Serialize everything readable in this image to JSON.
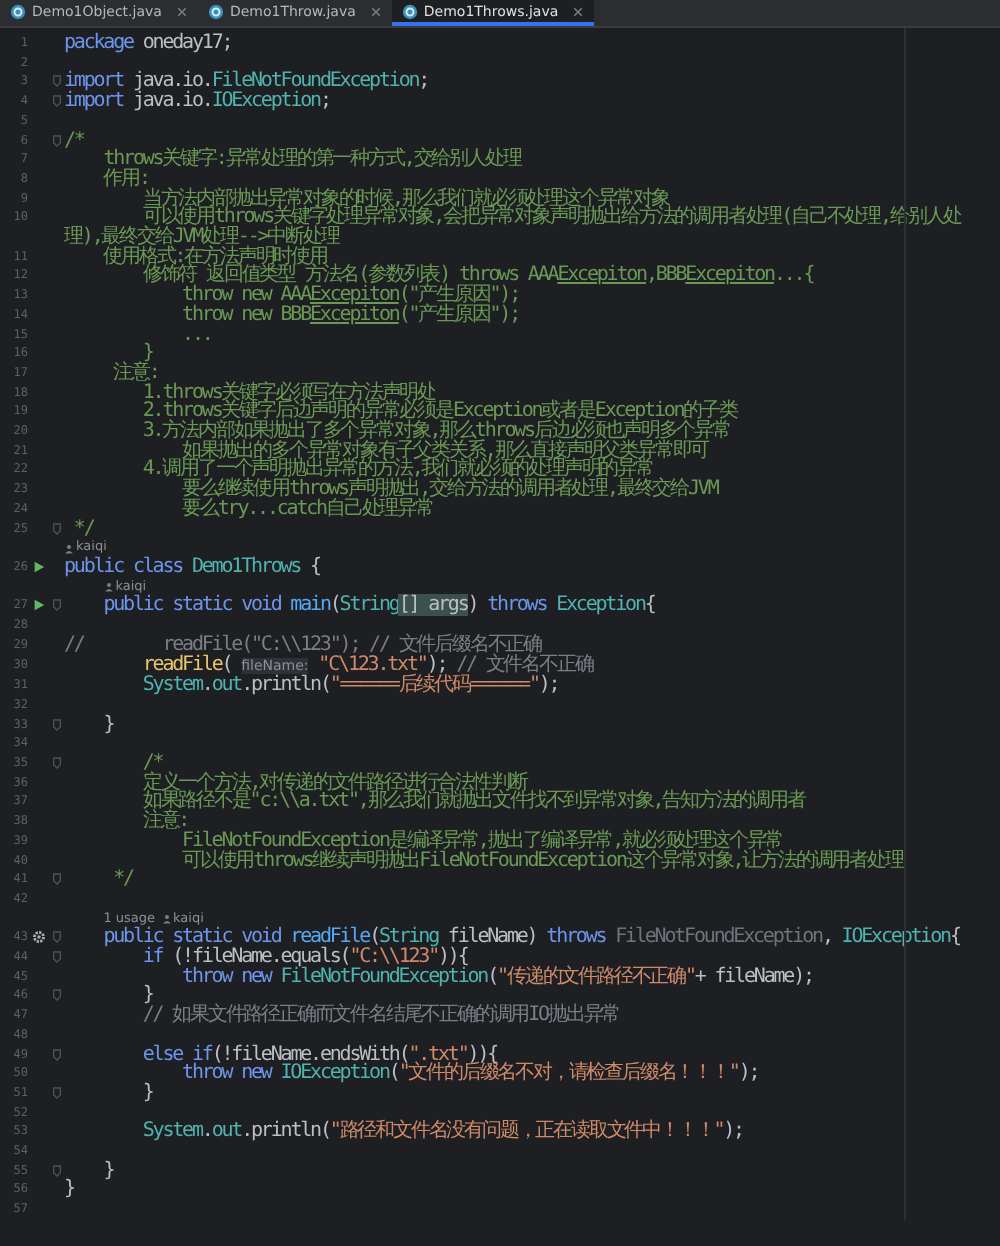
{
  "tabs": [
    {
      "label": "Demo1Object.java",
      "selected": false
    },
    {
      "label": "Demo1Throw.java",
      "selected": false
    },
    {
      "label": "Demo1Throws.java",
      "selected": true
    }
  ],
  "rows": [
    {
      "kind": "code",
      "number": "1",
      "tokens": [
        {
          "kind": "kw",
          "text": "package"
        },
        {
          "kind": "plain",
          "text": " oneday17;"
        }
      ]
    },
    {
      "kind": "code",
      "number": "2",
      "tokens": []
    },
    {
      "kind": "code",
      "number": "3",
      "fold": true,
      "tokens": [
        {
          "kind": "kw",
          "text": "import"
        },
        {
          "kind": "plain",
          "text": " java.io."
        },
        {
          "kind": "type",
          "text": "FileNotFoundException"
        },
        {
          "kind": "plain",
          "text": ";"
        }
      ]
    },
    {
      "kind": "code",
      "number": "4",
      "fold": true,
      "tokens": [
        {
          "kind": "kw",
          "text": "import"
        },
        {
          "kind": "plain",
          "text": " java.io."
        },
        {
          "kind": "type",
          "text": "IOException"
        },
        {
          "kind": "plain",
          "text": ";"
        }
      ]
    },
    {
      "kind": "code",
      "number": "5",
      "tokens": []
    },
    {
      "kind": "code",
      "number": "6",
      "fold": true,
      "tokens": [
        {
          "kind": "doc",
          "text": "/*"
        }
      ]
    },
    {
      "kind": "code",
      "number": "7",
      "tokens": [
        {
          "kind": "doc",
          "text": "    throws关键字:异常处理的第一种方式,交给别人处理"
        }
      ]
    },
    {
      "kind": "code",
      "number": "8",
      "tokens": [
        {
          "kind": "doc",
          "text": "    作用:"
        }
      ]
    },
    {
      "kind": "code",
      "number": "9",
      "tokens": [
        {
          "kind": "doc",
          "text": "        当方法内部抛出异常对象的时候,那么我们就必须处理这个异常对象"
        }
      ]
    },
    {
      "kind": "code",
      "number": "10",
      "tokens": [
        {
          "kind": "doc",
          "text": "        可以使用throws关键字处理异常对象,会把异常对象声明抛出给方法的调用者处理(自己不处理,给别人处理),最终交给JVM处理-->中断处理"
        }
      ]
    },
    {
      "kind": "code",
      "number": "11",
      "tokens": [
        {
          "kind": "doc",
          "text": "    使用格式:在方法声明时使用"
        }
      ]
    },
    {
      "kind": "code",
      "number": "12",
      "tokens": [
        {
          "kind": "doc",
          "text": "        修饰符 返回值类型 方法名(参数列表) throws AAA"
        },
        {
          "kind": "docu",
          "text": "Excepiton"
        },
        {
          "kind": "doc",
          "text": ",BBB"
        },
        {
          "kind": "docu",
          "text": "Excepiton"
        },
        {
          "kind": "doc",
          "text": "...{"
        }
      ]
    },
    {
      "kind": "code",
      "number": "13",
      "tokens": [
        {
          "kind": "doc",
          "text": "            throw new AAA"
        },
        {
          "kind": "docu",
          "text": "Excepiton"
        },
        {
          "kind": "doc",
          "text": "(\"产生原因\");"
        }
      ]
    },
    {
      "kind": "code",
      "number": "14",
      "tokens": [
        {
          "kind": "doc",
          "text": "            throw new BBB"
        },
        {
          "kind": "docu",
          "text": "Excepiton"
        },
        {
          "kind": "doc",
          "text": "(\"产生原因\");"
        }
      ]
    },
    {
      "kind": "code",
      "number": "15",
      "tokens": [
        {
          "kind": "doc",
          "text": "            ..."
        }
      ]
    },
    {
      "kind": "code",
      "number": "16",
      "tokens": [
        {
          "kind": "doc",
          "text": "        }"
        }
      ]
    },
    {
      "kind": "code",
      "number": "17",
      "tokens": [
        {
          "kind": "doc",
          "text": "     注意:"
        }
      ]
    },
    {
      "kind": "code",
      "number": "18",
      "tokens": [
        {
          "kind": "doc",
          "text": "        1.throws关键字必须写在方法声明处"
        }
      ]
    },
    {
      "kind": "code",
      "number": "19",
      "tokens": [
        {
          "kind": "doc",
          "text": "        2.throws关键字后边声明的异常必须是Exception或者是Exception的子类"
        }
      ]
    },
    {
      "kind": "code",
      "number": "20",
      "tokens": [
        {
          "kind": "doc",
          "text": "        3.方法内部如果抛出了多个异常对象,那么throws后边必须也声明多个异常"
        }
      ]
    },
    {
      "kind": "code",
      "number": "21",
      "tokens": [
        {
          "kind": "doc",
          "text": "            如果抛出的多个异常对象有子父类关系,那么直接声明父类异常即可"
        }
      ]
    },
    {
      "kind": "code",
      "number": "22",
      "tokens": [
        {
          "kind": "doc",
          "text": "        4.调用了一个声明抛出异常的方法,我们就必须的处理声明的异常"
        }
      ]
    },
    {
      "kind": "code",
      "number": "23",
      "tokens": [
        {
          "kind": "doc",
          "text": "            要么继续使用throws声明抛出,交给方法的调用者处理,最终交给JVM"
        }
      ]
    },
    {
      "kind": "code",
      "number": "24",
      "tokens": [
        {
          "kind": "doc",
          "text": "            要么try...catch自己处理异常"
        }
      ]
    },
    {
      "kind": "code",
      "number": "25",
      "fold": true,
      "tokens": [
        {
          "kind": "doc",
          "text": " */"
        }
      ]
    },
    {
      "kind": "hint",
      "usages": "",
      "author": "kaiqi"
    },
    {
      "kind": "code",
      "number": "26",
      "gutter": {
        "kind": "run"
      },
      "tokens": [
        {
          "kind": "kw",
          "text": "public class"
        },
        {
          "kind": "type",
          "text": " Demo1Throws"
        },
        {
          "kind": "plain",
          "text": " {"
        }
      ]
    },
    {
      "kind": "hint",
      "usages": "",
      "author": "kaiqi"
    },
    {
      "kind": "code",
      "number": "27",
      "gutter": {
        "kind": "run"
      },
      "fold": true,
      "tokens": [
        {
          "kind": "kw",
          "text": "    public static void"
        },
        {
          "kind": "method",
          "text": " main"
        },
        {
          "kind": "plain",
          "text": "("
        },
        {
          "kind": "type",
          "text": "String"
        },
        {
          "kind": "match",
          "text": "[]"
        },
        {
          "kind": "match",
          "text": " args"
        },
        {
          "kind": "plain",
          "text": ") "
        },
        {
          "kind": "kw",
          "text": "throws"
        },
        {
          "kind": "type",
          "text": " Exception"
        },
        {
          "kind": "plain",
          "text": "{"
        }
      ]
    },
    {
      "kind": "code",
      "number": "28",
      "tokens": []
    },
    {
      "kind": "code",
      "number": "29",
      "tokens": [
        {
          "kind": "comment",
          "text": "//        readFile(\"C:\\\\123\"); // 文件后缀名不正确"
        }
      ]
    },
    {
      "kind": "code",
      "number": "30",
      "tokens": [
        {
          "kind": "call",
          "text": "        readFile"
        },
        {
          "kind": "plain",
          "text": "( "
        },
        {
          "kind": "inlay",
          "text": "fileName:"
        },
        {
          "kind": "string",
          "text": " \"C\\123.txt\""
        },
        {
          "kind": "plain",
          "text": "); "
        },
        {
          "kind": "comment",
          "text": "// 文件名不正确"
        }
      ]
    },
    {
      "kind": "code",
      "number": "31",
      "tokens": [
        {
          "kind": "type",
          "text": "        System"
        },
        {
          "kind": "plain",
          "text": "."
        },
        {
          "kind": "field",
          "text": "out"
        },
        {
          "kind": "plain",
          "text": ".println("
        },
        {
          "kind": "string",
          "text": "\"======后续代码======\""
        },
        {
          "kind": "plain",
          "text": ");"
        }
      ]
    },
    {
      "kind": "code",
      "number": "32",
      "tokens": []
    },
    {
      "kind": "code",
      "number": "33",
      "fold": true,
      "tokens": [
        {
          "kind": "plain",
          "text": "    }"
        }
      ]
    },
    {
      "kind": "code",
      "number": "34",
      "tokens": []
    },
    {
      "kind": "code",
      "number": "35",
      "fold": true,
      "tokens": [
        {
          "kind": "doc",
          "text": "        /*"
        }
      ]
    },
    {
      "kind": "code",
      "number": "36",
      "tokens": [
        {
          "kind": "doc",
          "text": "        定义一个方法,对传递的文件路径进行合法性判断"
        }
      ]
    },
    {
      "kind": "code",
      "number": "37",
      "tokens": [
        {
          "kind": "doc",
          "text": "        如果路径不是\"c:\\\\a.txt\",那么我们就抛出文件找不到异常对象,告知方法的调用者"
        }
      ]
    },
    {
      "kind": "code",
      "number": "38",
      "tokens": [
        {
          "kind": "doc",
          "text": "        注意:"
        }
      ]
    },
    {
      "kind": "code",
      "number": "39",
      "tokens": [
        {
          "kind": "doc",
          "text": "            FileNotFoundException是编译异常,抛出了编译异常,就必须处理这个异常"
        }
      ]
    },
    {
      "kind": "code",
      "number": "40",
      "tokens": [
        {
          "kind": "doc",
          "text": "            可以使用throws继续声明抛出FileNotFoundException这个异常对象,让方法的调用者处理"
        }
      ]
    },
    {
      "kind": "code",
      "number": "41",
      "fold": true,
      "tokens": [
        {
          "kind": "doc",
          "text": "     */"
        }
      ]
    },
    {
      "kind": "code",
      "number": "42",
      "tokens": []
    },
    {
      "kind": "hint",
      "usages": "1 usage",
      "author": "kaiqi"
    },
    {
      "kind": "code",
      "number": "43",
      "gutter": {
        "kind": "override"
      },
      "fold": true,
      "tokens": [
        {
          "kind": "kw",
          "text": "    public static void"
        },
        {
          "kind": "method",
          "text": " readFile"
        },
        {
          "kind": "plain",
          "text": "("
        },
        {
          "kind": "type",
          "text": "String"
        },
        {
          "kind": "plain",
          "text": " fileName) "
        },
        {
          "kind": "kw",
          "text": "throws"
        },
        {
          "kind": "unused",
          "text": " FileNotFoundException"
        },
        {
          "kind": "plain",
          "text": ", "
        },
        {
          "kind": "type",
          "text": "IOException"
        },
        {
          "kind": "plain",
          "text": "{"
        }
      ]
    },
    {
      "kind": "code",
      "number": "44",
      "fold": true,
      "tokens": [
        {
          "kind": "kw",
          "text": "        if"
        },
        {
          "kind": "plain",
          "text": " (!fileName.equals("
        },
        {
          "kind": "string",
          "text": "\"C:\\\\123\""
        },
        {
          "kind": "plain",
          "text": ")){"
        }
      ]
    },
    {
      "kind": "code",
      "number": "45",
      "tokens": [
        {
          "kind": "kw",
          "text": "            throw new"
        },
        {
          "kind": "type",
          "text": " FileNotFoundException"
        },
        {
          "kind": "plain",
          "text": "("
        },
        {
          "kind": "string",
          "text": "\"传递的文件路径不正确\""
        },
        {
          "kind": "plain",
          "text": "+ fileName);"
        }
      ]
    },
    {
      "kind": "code",
      "number": "46",
      "fold": true,
      "tokens": [
        {
          "kind": "plain",
          "text": "        }"
        }
      ]
    },
    {
      "kind": "code",
      "number": "47",
      "tokens": [
        {
          "kind": "comment",
          "text": "        // 如果文件路径正确而文件名结尾不正确的调用IO抛出异常"
        }
      ]
    },
    {
      "kind": "code",
      "number": "48",
      "tokens": []
    },
    {
      "kind": "code",
      "number": "49",
      "fold": true,
      "tokens": [
        {
          "kind": "kw",
          "text": "        else if"
        },
        {
          "kind": "plain",
          "text": "(!fileName.endsWith("
        },
        {
          "kind": "string",
          "text": "\".txt\""
        },
        {
          "kind": "plain",
          "text": ")){"
        }
      ]
    },
    {
      "kind": "code",
      "number": "50",
      "tokens": [
        {
          "kind": "kw",
          "text": "            throw new"
        },
        {
          "kind": "type",
          "text": " IOException"
        },
        {
          "kind": "plain",
          "text": "("
        },
        {
          "kind": "string",
          "text": "\"文件的后缀名不对，请检查后缀名！！！\""
        },
        {
          "kind": "plain",
          "text": ");"
        }
      ]
    },
    {
      "kind": "code",
      "number": "51",
      "fold": true,
      "tokens": [
        {
          "kind": "plain",
          "text": "        }"
        }
      ]
    },
    {
      "kind": "code",
      "number": "52",
      "tokens": []
    },
    {
      "kind": "code",
      "number": "53",
      "tokens": [
        {
          "kind": "type",
          "text": "        System"
        },
        {
          "kind": "plain",
          "text": "."
        },
        {
          "kind": "field",
          "text": "out"
        },
        {
          "kind": "plain",
          "text": ".println("
        },
        {
          "kind": "string",
          "text": "\"路径和文件名没有问题，正在读取文件中！！！\""
        },
        {
          "kind": "plain",
          "text": ");"
        }
      ]
    },
    {
      "kind": "code",
      "number": "54",
      "tokens": []
    },
    {
      "kind": "code",
      "number": "55",
      "fold": true,
      "tokens": [
        {
          "kind": "plain",
          "text": "    }"
        }
      ]
    },
    {
      "kind": "code",
      "number": "56",
      "tokens": [
        {
          "kind": "plain",
          "text": "}"
        }
      ]
    },
    {
      "kind": "code",
      "number": "57",
      "tokens": []
    }
  ]
}
